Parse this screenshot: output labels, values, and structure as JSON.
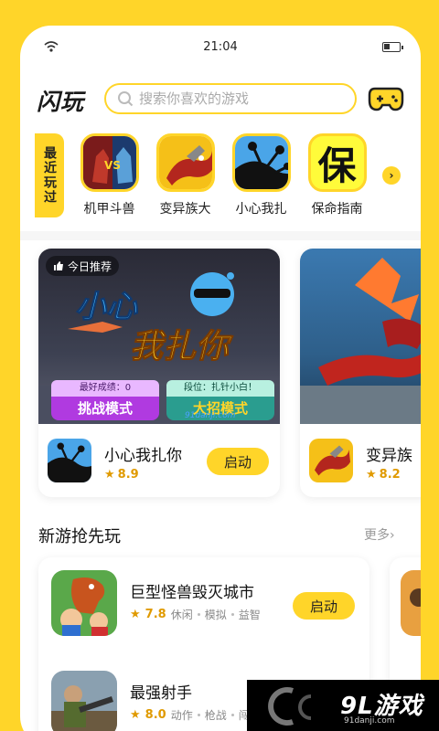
{
  "status": {
    "time": "21:04"
  },
  "header": {
    "logo": "闪玩",
    "search_placeholder": "搜索你喜欢的游戏"
  },
  "recent": {
    "tag": "最近玩过",
    "items": [
      {
        "label": "机甲斗兽"
      },
      {
        "label": "变异族大"
      },
      {
        "label": "小心我扎"
      },
      {
        "label": "保命指南"
      }
    ],
    "icon4_glyph": "保"
  },
  "featured": [
    {
      "badge": "今日推荐",
      "name": "小心我扎你",
      "rating": "8.9",
      "button": "启动",
      "banner_title_1": "小心",
      "banner_title_2": "我扎你",
      "best_score_label": "最好成绩：0",
      "mode1": "挑战模式",
      "rank_label": "段位：扎针小白！",
      "mode2": "大招模式"
    },
    {
      "name": "变异族",
      "rating": "8.2"
    }
  ],
  "new_games": {
    "title": "新游抢先玩",
    "more": "更多",
    "items": [
      {
        "name": "巨型怪兽毁灭城市",
        "rating": "7.8",
        "tags": [
          "休闲",
          "模拟",
          "益智"
        ],
        "button": "启动"
      },
      {
        "name": "最强射手",
        "rating": "8.0",
        "tags": [
          "动作",
          "枪战",
          "闯关"
        ]
      }
    ]
  },
  "watermark": {
    "logo": "9L游戏",
    "url": "91danji.com",
    "mini": "91danji.com"
  },
  "colors": {
    "accent": "#ffd529",
    "rating": "#e09a00"
  }
}
